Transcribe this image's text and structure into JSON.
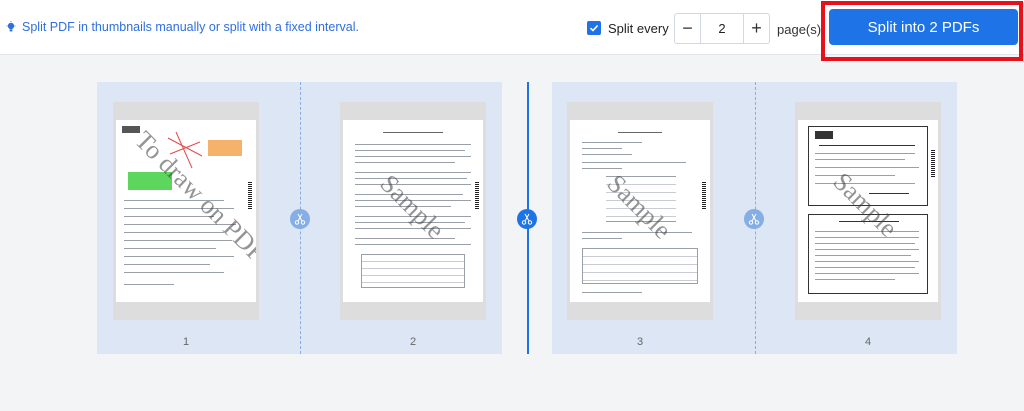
{
  "toolbar": {
    "hint": "Split PDF in thumbnails manually or split with a fixed interval.",
    "split_every_label": "Split every",
    "split_every_checked": true,
    "interval_value": "2",
    "minus_label": "−",
    "plus_label": "+",
    "pages_label": "page(s)",
    "split_button_label": "Split into 2 PDFs"
  },
  "pages": [
    {
      "number": "1",
      "watermark": "To draw on PDF"
    },
    {
      "number": "2",
      "watermark": "Sample"
    },
    {
      "number": "3",
      "watermark": "Sample"
    },
    {
      "number": "4",
      "watermark": "Sample"
    }
  ],
  "colors": {
    "accent": "#1e74e6",
    "highlight": "#e8101a",
    "group_bg": "#dce6f5"
  }
}
